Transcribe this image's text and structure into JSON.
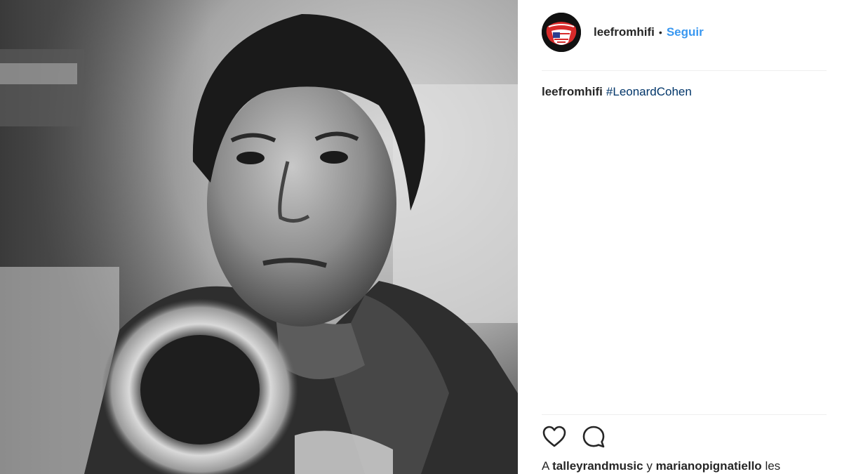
{
  "post": {
    "photo_alt": "",
    "header": {
      "username": "leefromhifi",
      "separator": "•",
      "follow_label": "Seguir"
    },
    "caption": {
      "username": "leefromhifi",
      "hashtag": "#LeonardCohen"
    },
    "actions": {
      "like_icon": "heart-icon",
      "comment_icon": "comment-bubble-icon"
    },
    "likes": {
      "prefix": "A",
      "user1": "talleyrandmusic",
      "joiner": "y",
      "user2": "marianopignatiello",
      "suffix": "les"
    }
  },
  "colors": {
    "accent": "#3897f0",
    "hashtag": "#003569",
    "text": "#262626",
    "divider": "#efefef"
  }
}
